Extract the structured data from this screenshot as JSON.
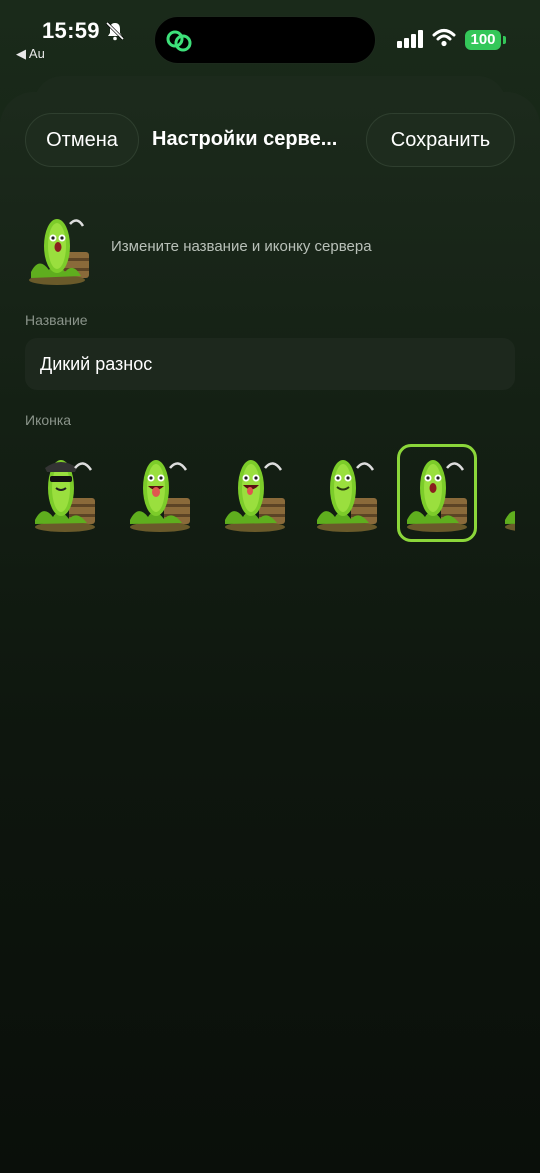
{
  "status_bar": {
    "time": "15:59",
    "back_app": "◀ Au",
    "battery": "100"
  },
  "header": {
    "cancel_label": "Отмена",
    "title": "Настройки серве...",
    "save_label": "Сохранить"
  },
  "server": {
    "hint": "Измените название и иконку сервера"
  },
  "name_section": {
    "label": "Название",
    "value": "Дикий разнос"
  },
  "icon_section": {
    "label": "Иконка",
    "options": [
      {
        "name": "pickle-sunglasses-icon",
        "selected": false
      },
      {
        "name": "pickle-tongue-icon",
        "selected": false
      },
      {
        "name": "pickle-grin-icon",
        "selected": false
      },
      {
        "name": "pickle-smile-icon",
        "selected": false
      },
      {
        "name": "pickle-shocked-icon",
        "selected": true
      },
      {
        "name": "pickle-partial-icon",
        "selected": false
      }
    ]
  },
  "colors": {
    "accent": "#8bd63a",
    "battery": "#34c759",
    "background": "#0a0f0a"
  }
}
